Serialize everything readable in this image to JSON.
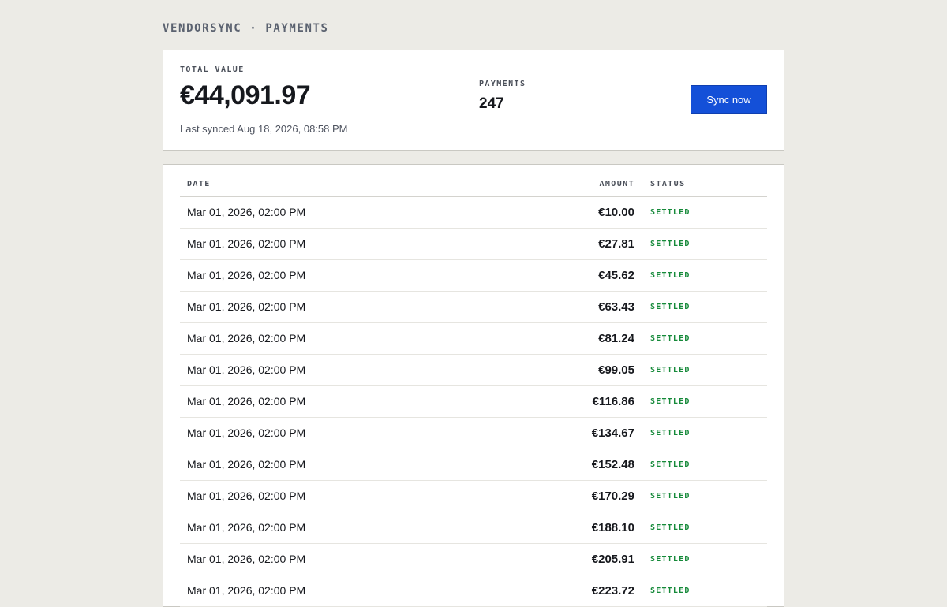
{
  "header": {
    "brand": "VENDORSYNC",
    "separator": "·",
    "section": "PAYMENTS"
  },
  "summary": {
    "total_value_label": "TOTAL VALUE",
    "total_value": "€44,091.97",
    "last_synced": "Last synced Aug 18, 2026, 08:58 PM",
    "payments_label": "PAYMENTS",
    "payments_count": "247",
    "sync_button_label": "Sync now"
  },
  "colors": {
    "accent": "#1450d8",
    "status_settled": "#168a3a",
    "background": "#ecebe6"
  },
  "table": {
    "columns": [
      "DATE",
      "AMOUNT",
      "STATUS"
    ],
    "rows": [
      {
        "date": "Mar 01, 2026, 02:00 PM",
        "amount": "€10.00",
        "status": "SETTLED"
      },
      {
        "date": "Mar 01, 2026, 02:00 PM",
        "amount": "€27.81",
        "status": "SETTLED"
      },
      {
        "date": "Mar 01, 2026, 02:00 PM",
        "amount": "€45.62",
        "status": "SETTLED"
      },
      {
        "date": "Mar 01, 2026, 02:00 PM",
        "amount": "€63.43",
        "status": "SETTLED"
      },
      {
        "date": "Mar 01, 2026, 02:00 PM",
        "amount": "€81.24",
        "status": "SETTLED"
      },
      {
        "date": "Mar 01, 2026, 02:00 PM",
        "amount": "€99.05",
        "status": "SETTLED"
      },
      {
        "date": "Mar 01, 2026, 02:00 PM",
        "amount": "€116.86",
        "status": "SETTLED"
      },
      {
        "date": "Mar 01, 2026, 02:00 PM",
        "amount": "€134.67",
        "status": "SETTLED"
      },
      {
        "date": "Mar 01, 2026, 02:00 PM",
        "amount": "€152.48",
        "status": "SETTLED"
      },
      {
        "date": "Mar 01, 2026, 02:00 PM",
        "amount": "€170.29",
        "status": "SETTLED"
      },
      {
        "date": "Mar 01, 2026, 02:00 PM",
        "amount": "€188.10",
        "status": "SETTLED"
      },
      {
        "date": "Mar 01, 2026, 02:00 PM",
        "amount": "€205.91",
        "status": "SETTLED"
      },
      {
        "date": "Mar 01, 2026, 02:00 PM",
        "amount": "€223.72",
        "status": "SETTLED"
      }
    ]
  }
}
